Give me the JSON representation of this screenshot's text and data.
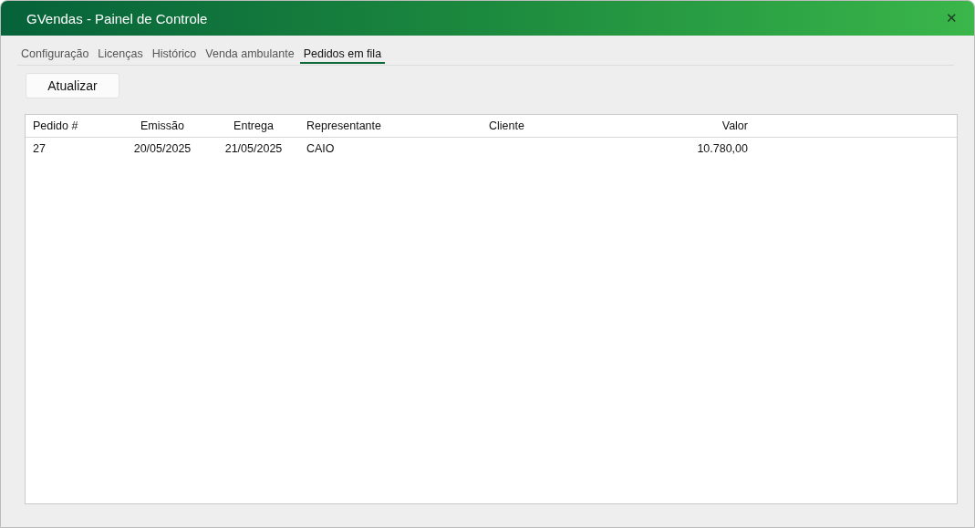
{
  "window": {
    "title": "GVendas - Painel de Controle",
    "close": "✕"
  },
  "tabs": [
    {
      "label": "Configuração",
      "selected": false
    },
    {
      "label": "Licenças",
      "selected": false
    },
    {
      "label": "Histórico",
      "selected": false
    },
    {
      "label": "Venda ambulante",
      "selected": false
    },
    {
      "label": "Pedidos em fila",
      "selected": true
    }
  ],
  "refresh_button": "Atualizar",
  "table": {
    "columns": [
      "Pedido #",
      "Emissão",
      "Entrega",
      "Representante",
      "Cliente",
      "Valor"
    ],
    "rows": [
      {
        "cells": [
          "27",
          "20/05/2025",
          "21/05/2025",
          "CAIO",
          null,
          "10.780,00"
        ]
      }
    ]
  }
}
